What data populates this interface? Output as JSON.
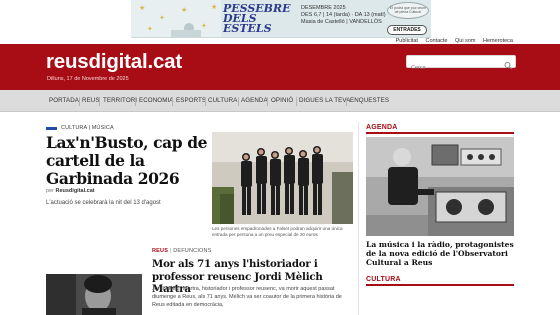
{
  "ad": {
    "title": "PESSEBRE DELS ESTELS",
    "dates": "DESEMBRE 2025\nDES 6,7 | 14 (tarda) · DA 13 (matí)\nMasia de Castelló | VANDELLÒS",
    "badge_text": "Et podrà que puc veure de plena Cultura!",
    "entrades_label": "ENTRADES"
  },
  "util_links": [
    "Publicitat",
    "Contacte",
    "Qui som",
    "Hemeroteca"
  ],
  "header": {
    "logo": "reusdigital.cat",
    "date": "Dilluns, 17 de Novembre de 2025",
    "search_placeholder": "Cerca"
  },
  "nav": [
    "PORTADA",
    "REUS",
    "TERRITORI",
    "ECONOMIA",
    "ESPORTS",
    "CULTURA",
    "AGENDA",
    "OPINIÓ",
    "DIGUES LA TEVA",
    "ENQUESTES"
  ],
  "article1": {
    "category": "CULTURA | MÚSICA",
    "title": "Lax'n'Busto, cap de cartell de la Garbinada 2026",
    "byline_prefix": "per",
    "author": "Reusdigital.cat",
    "lead": "L'actuació se celebrarà la nit del 13 d'agost",
    "caption": "Les persones empadronades a Falset podran adquirir una única entrada per persona a un preu especial de 20 euros"
  },
  "article2": {
    "category_main": "REUS",
    "category_sub": "DEFUNCIONS",
    "title": "Mor als 71 anys l'historiador i professor reusenc Jordi Mèlich Martra",
    "lead": "Jordi Mèlich Martra, historiador i professor reusenc, va morir aquest passat diumenge a Reus, als 71 anys. Mèlich va ser coautor de la primera història de Reus editada en democràcia,"
  },
  "sidebar": {
    "agenda_label": "AGENDA",
    "agenda_title": "La música i la ràdio, protagonistes de la nova edició de l'Observatori Cultural a Reus",
    "cultura_label": "CULTURA"
  },
  "colors": {
    "brand_red": "#a80c14",
    "category_blue": "#1f4ea8",
    "nav_bg": "#dcdcdc"
  }
}
